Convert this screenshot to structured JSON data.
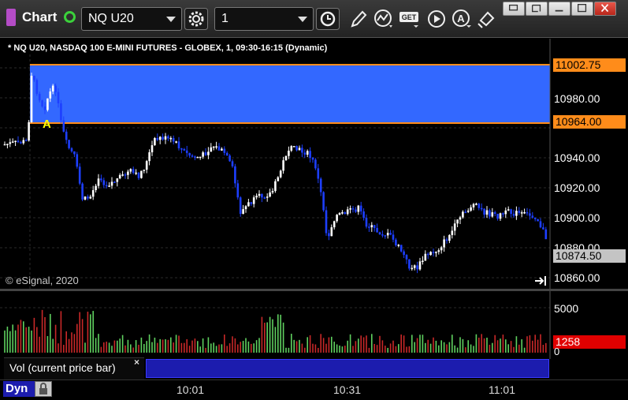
{
  "toolbar": {
    "title": "Chart",
    "symbol": "NQ U20",
    "interval": "1",
    "icons": [
      "gear-icon",
      "clock-icon",
      "pencil-icon",
      "studies-icon",
      "get-icon",
      "play-icon",
      "alert-icon",
      "edit-icon"
    ],
    "window_buttons": [
      "restore-icon",
      "tile-icon",
      "minimize-icon",
      "close-icon"
    ]
  },
  "chart": {
    "header": "* NQ U20, NASDAQ 100 E-MINI FUTURES - GLOBEX, 1, 09:30-16:15 (Dynamic)",
    "copyright": "© eSignal, 2020",
    "marker_label": "A",
    "price_labels": [
      "10980.00",
      "10940.00",
      "10920.00",
      "10900.00",
      "10880.00",
      "10860.00"
    ],
    "tags": {
      "upper": "11002.75",
      "lower": "10964.00",
      "last": "10874.50"
    },
    "colors": {
      "range_fill": "#3368ff",
      "tag_orange": "#ff8c1a",
      "up_bar": "#ffffff",
      "down_bar": "#1d3fff"
    }
  },
  "volume": {
    "labels": [
      "5000",
      "0"
    ],
    "current": "1258",
    "legend": "Vol (current price bar)",
    "close_glyph": "×"
  },
  "status": {
    "mode": "Dyn",
    "times": [
      "10:01",
      "10:31",
      "11:01"
    ]
  }
}
